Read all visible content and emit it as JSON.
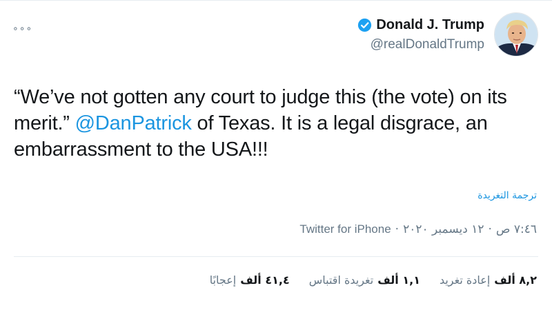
{
  "more_menu": "∘∘∘",
  "author": {
    "display_name": "Donald J. Trump",
    "handle": "@realDonaldTrump"
  },
  "tweet": {
    "text_part1": "“We’ve not gotten any court to judge this (the vote) on its merit.” ",
    "mention": "@DanPatrick",
    "text_part2": " of Texas. It is a legal disgrace, an embarrassment to the USA!!!"
  },
  "translate_label": "ترجمة التغريدة",
  "meta": {
    "time": "٧:٤٦ ص",
    "separator": "·",
    "date": "١٢ ديسمبر ٢٠٢٠",
    "source": "Twitter for iPhone"
  },
  "stats": [
    {
      "count": "٨,٢ ألف",
      "label": "إعادة تغريد"
    },
    {
      "count": "١,١ ألف",
      "label": "تغريدة اقتباس"
    },
    {
      "count": "٤١,٤ ألف",
      "label": "إعجابًا"
    }
  ],
  "colors": {
    "link": "#1b95e0",
    "verified": "#1da1f2",
    "muted": "#657786",
    "text": "#14171a"
  }
}
